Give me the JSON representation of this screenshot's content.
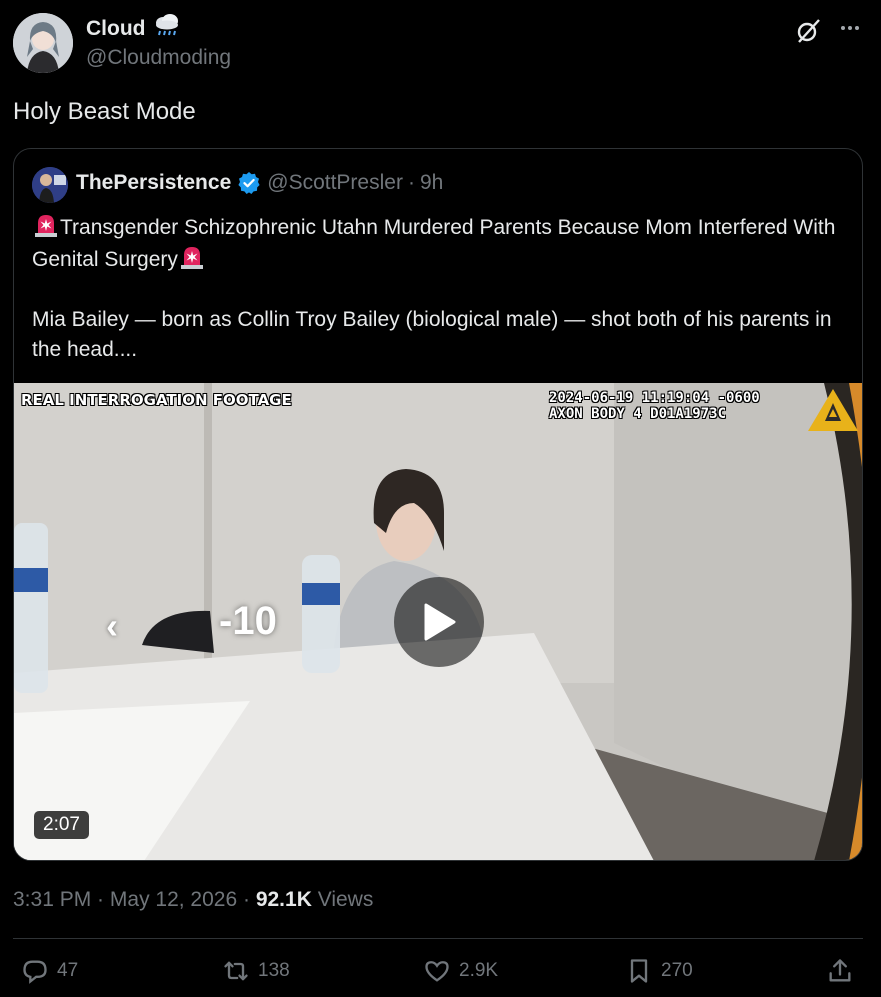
{
  "author": {
    "name": "Cloud",
    "name_emoji": "🌧",
    "handle": "@Cloudmoding"
  },
  "tweet": {
    "text": "Holy Beast Mode"
  },
  "quoted": {
    "name": "ThePersistence",
    "handle": "@ScottPresler",
    "separator": "·",
    "time": "9h",
    "line1": "Transgender Schizophrenic Utahn Murdered Parents Because Mom Interfered With Genital Surgery",
    "line2": "Mia Bailey — born as Collin Troy Bailey (biological male) — shot both of his parents in the head...."
  },
  "video": {
    "overlay_label": "REAL INTERROGATION FOOTAGE",
    "stamp": "2024-06-19 11:19:04 -0600\nAXON BODY 4 D01A1973C",
    "rewind_chevron": "‹",
    "rewind_label": "-10",
    "duration": "2:07"
  },
  "meta": {
    "time": "3:31 PM",
    "sep1": " · ",
    "date": "May 12, 2026",
    "sep2": " · ",
    "views_count": "92.1K",
    "views_label": " Views"
  },
  "actions": {
    "replies": "47",
    "reposts": "138",
    "likes": "2.9K",
    "bookmarks": "270"
  },
  "colors": {
    "background": "#000000",
    "text_primary": "#e7e9ea",
    "text_secondary": "#71767b",
    "border": "#2f3336",
    "verified": "#1d9bf0",
    "siren": "#e0245e"
  },
  "icons": [
    "grok-icon",
    "more-icon",
    "verified-icon",
    "siren-icon",
    "play-icon",
    "axon-logo",
    "reply-icon",
    "repost-icon",
    "like-icon",
    "bookmark-icon",
    "share-icon"
  ]
}
